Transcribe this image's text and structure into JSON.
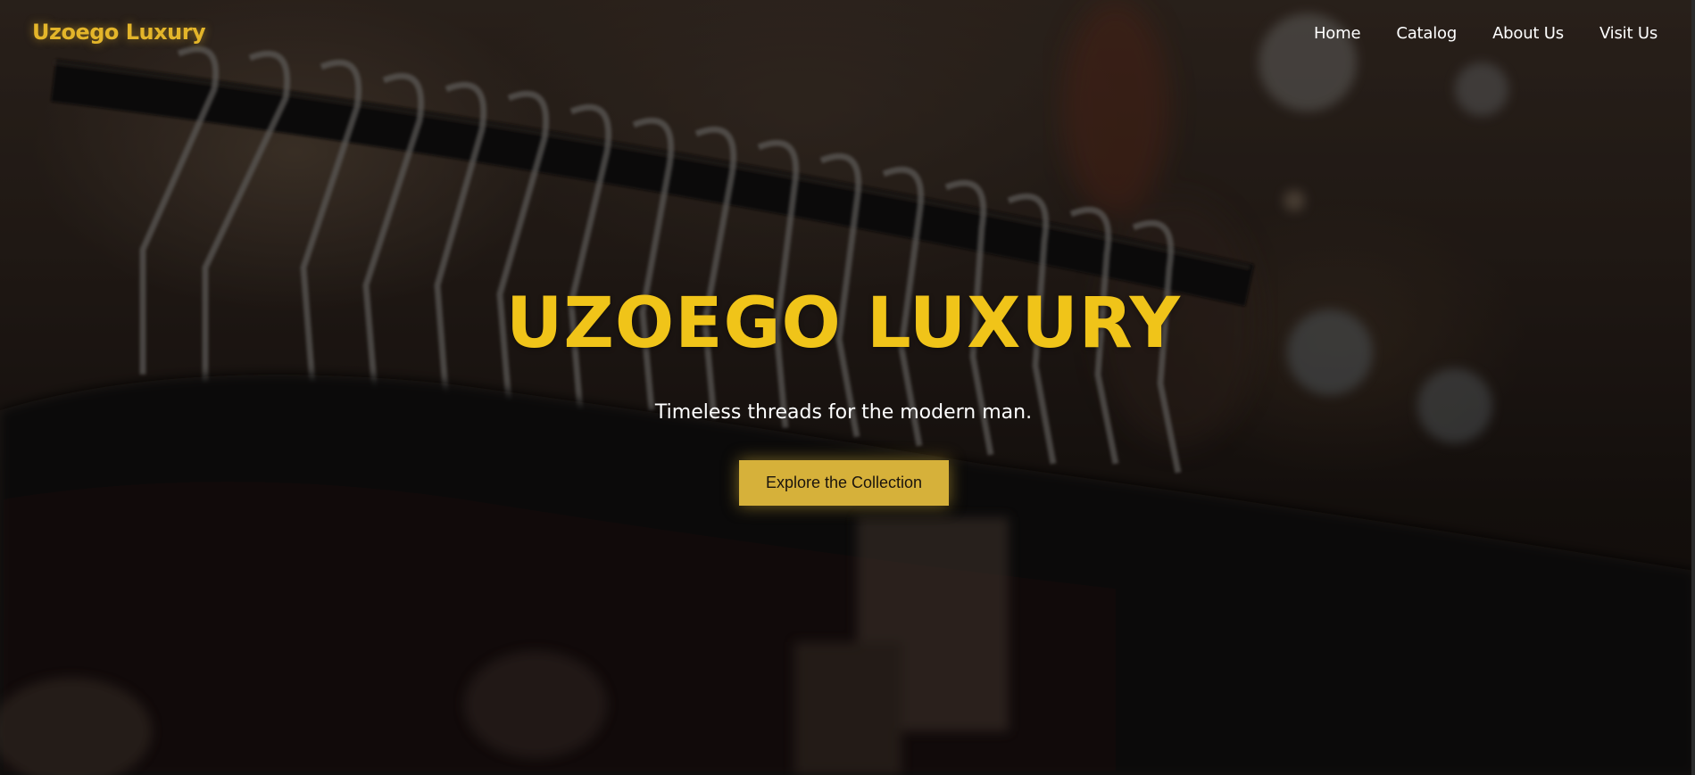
{
  "brand": {
    "name": "Uzoego Luxury",
    "accent_color": "#e3b52a"
  },
  "nav": {
    "items": [
      {
        "label": "Home"
      },
      {
        "label": "Catalog"
      },
      {
        "label": "About Us"
      },
      {
        "label": "Visit Us"
      }
    ]
  },
  "hero": {
    "title": "UZOEGO LUXURY",
    "subtitle": "Timeless threads for the modern man.",
    "cta_label": "Explore the Collection",
    "title_color": "#f0c419",
    "button_color": "#d6b13a",
    "background": "clothing-rack-photo"
  }
}
